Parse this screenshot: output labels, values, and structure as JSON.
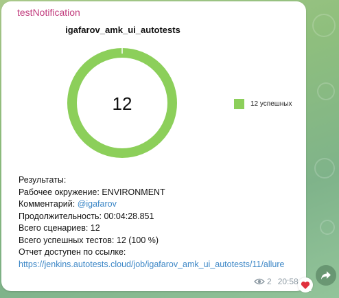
{
  "message": {
    "sender": "testNotification",
    "views": "2",
    "time": "20:58"
  },
  "chart_data": {
    "type": "pie",
    "title": "igafarov_amk_ui_autotests",
    "center_label": "12",
    "categories": [
      "12 успешных"
    ],
    "values": [
      12
    ],
    "colors": [
      "#8ccf5a"
    ],
    "legend": "right"
  },
  "info": {
    "results_label": "Результаты:",
    "env_label": "Рабочее окружение:",
    "env_value": " ENVIRONMENT",
    "comment_label": "Комментарий:",
    "comment_value": "@igafarov",
    "duration_label": "Продолжительность:",
    "duration_value": " 00:04:28.851",
    "scenarios_label": "Всего сценариев:",
    "scenarios_value": " 12",
    "passed_label": "Всего успешных тестов:",
    "passed_value": " 12 (100 %)",
    "report_label": "Отчет доступен по ссылке:",
    "report_url": "https://jenkins.autotests.cloud/job/igafarov_amk_ui_autotests/11/allure"
  },
  "colors": {
    "sender": "#c13a7c",
    "link": "#3b86c6",
    "bubble": "#ffffff"
  }
}
